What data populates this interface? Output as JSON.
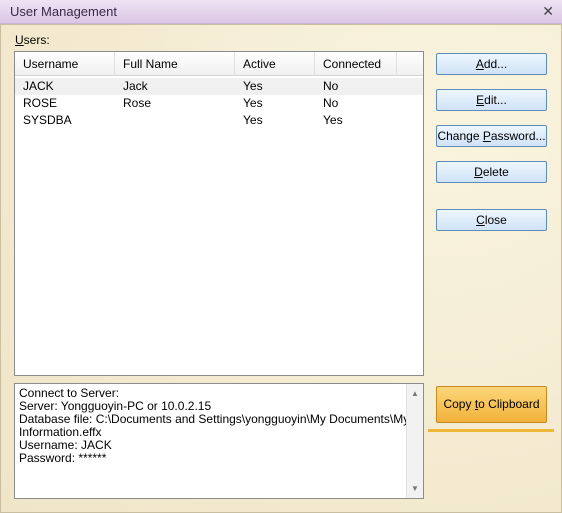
{
  "window": {
    "title": "User Management",
    "close_glyph": "✕"
  },
  "users_label_accel": "U",
  "users_label_rest": "sers:",
  "columns": [
    "Username",
    "Full Name",
    "Active",
    "Connected"
  ],
  "rows": [
    {
      "username": "JACK",
      "fullname": "Jack",
      "active": "Yes",
      "connected": "No"
    },
    {
      "username": "ROSE",
      "fullname": "Rose",
      "active": "Yes",
      "connected": "No"
    },
    {
      "username": "SYSDBA",
      "fullname": "",
      "active": "Yes",
      "connected": "Yes"
    }
  ],
  "buttons": {
    "add": {
      "accel": "A",
      "rest": "dd..."
    },
    "edit": {
      "accel": "E",
      "rest": "dit..."
    },
    "change_password": {
      "pre": "Change ",
      "accel": "P",
      "rest": "assword..."
    },
    "delete": {
      "accel": "D",
      "rest": "elete"
    },
    "close": {
      "accel": "C",
      "rest": "lose"
    },
    "copy": {
      "pre": "Copy ",
      "accel": "t",
      "rest": "o Clipboard"
    }
  },
  "info": {
    "line1": "Connect to Server:",
    "line2": "",
    "line3": "Server: Yongguoyin-PC or 10.0.2.15",
    "line4": "Database file: C:\\Documents and Settings\\yongguoyin\\My Documents\\My",
    "line5": "Information.effx",
    "line6": "Username: JACK",
    "line7": "Password: ******"
  },
  "colors": {
    "accent": "#f0b83a",
    "button_border": "#5f8bb8"
  }
}
